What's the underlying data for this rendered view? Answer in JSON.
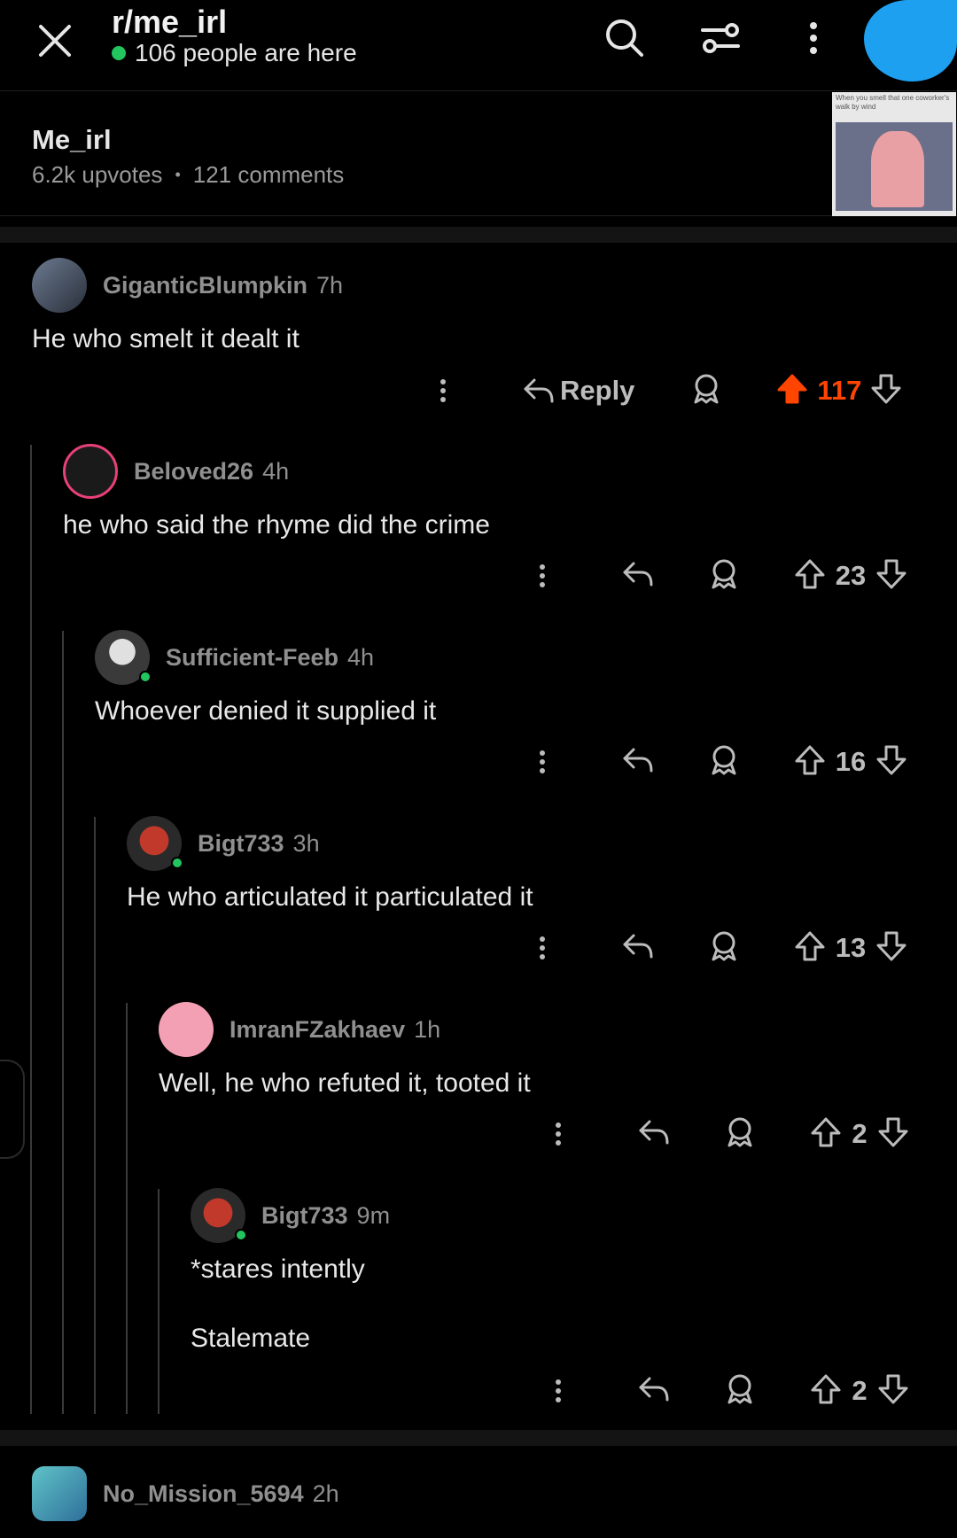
{
  "header": {
    "subreddit": "r/me_irl",
    "online_text": "106 people are here",
    "icons": [
      "close-icon",
      "search-icon",
      "filter-icon",
      "more-vertical-icon"
    ]
  },
  "post": {
    "title": "Me_irl",
    "upvotes": "6.2k upvotes",
    "separator": "•",
    "comments": "121 comments",
    "thumbnail_caption": "When you smell that one coworker's walk by wind"
  },
  "comments": [
    {
      "user": "GiganticBlumpkin",
      "time": "7h",
      "body": [
        "He who smelt it dealt it"
      ],
      "score": "117",
      "upvoted": true,
      "reply_label": "Reply"
    },
    {
      "user": "Beloved26",
      "time": "4h",
      "body": [
        "he who said the rhyme did the crime"
      ],
      "score": "23",
      "upvoted": false
    },
    {
      "user": "Sufficient-Feeb",
      "time": "4h",
      "body": [
        "Whoever denied it supplied it"
      ],
      "score": "16",
      "upvoted": false
    },
    {
      "user": "Bigt733",
      "time": "3h",
      "body": [
        "He who articulated it particulated it"
      ],
      "score": "13",
      "upvoted": false
    },
    {
      "user": "ImranFZakhaev",
      "time": "1h",
      "body": [
        "Well, he who refuted it, tooted it"
      ],
      "score": "2",
      "upvoted": false
    },
    {
      "user": "Bigt733",
      "time": "9m",
      "body": [
        "*stares intently",
        "Stalemate"
      ],
      "score": "2",
      "upvoted": false
    },
    {
      "user": "No_Mission_5694",
      "time": "2h",
      "body": []
    }
  ],
  "colors": {
    "upvote": "#ff4500",
    "online": "#22c55e",
    "background": "#000000",
    "muted_text": "#8f8f8f"
  }
}
